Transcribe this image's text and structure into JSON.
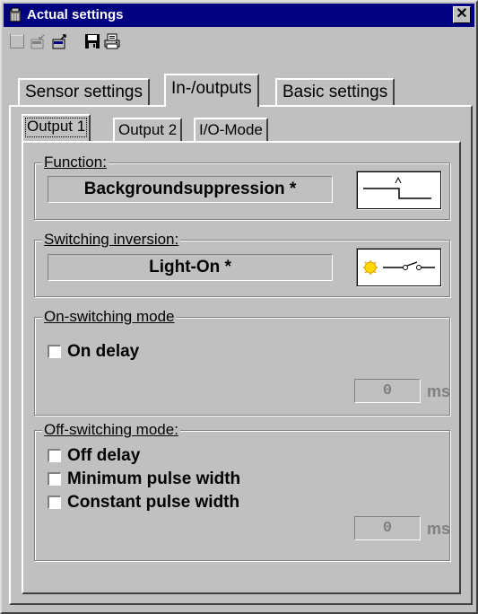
{
  "window": {
    "title": "Actual settings",
    "close_glyph": "✕"
  },
  "toolbar": {
    "buttons": [
      {
        "name": "new-icon"
      },
      {
        "name": "read-from-device-icon"
      },
      {
        "name": "write-to-device-icon"
      },
      {
        "name": "save-icon"
      },
      {
        "name": "print-icon"
      }
    ]
  },
  "tabs": [
    "Sensor settings",
    "In-/outputs",
    "Basic settings"
  ],
  "subtabs": [
    "Output 1",
    "Output 2",
    "I/O-Mode"
  ],
  "function": {
    "label": "Function:",
    "value": "Backgroundsuppression *"
  },
  "inversion": {
    "label": "Switching inversion:",
    "value": "Light-On *"
  },
  "on_mode": {
    "label": "On-switching mode",
    "on_delay": "On delay",
    "value": "0",
    "unit": "ms"
  },
  "off_mode": {
    "label": "Off-switching mode:",
    "off_delay": "Off delay",
    "min_pulse": "Minimum pulse width",
    "const_pulse": "Constant pulse width",
    "value": "0",
    "unit": "ms"
  }
}
